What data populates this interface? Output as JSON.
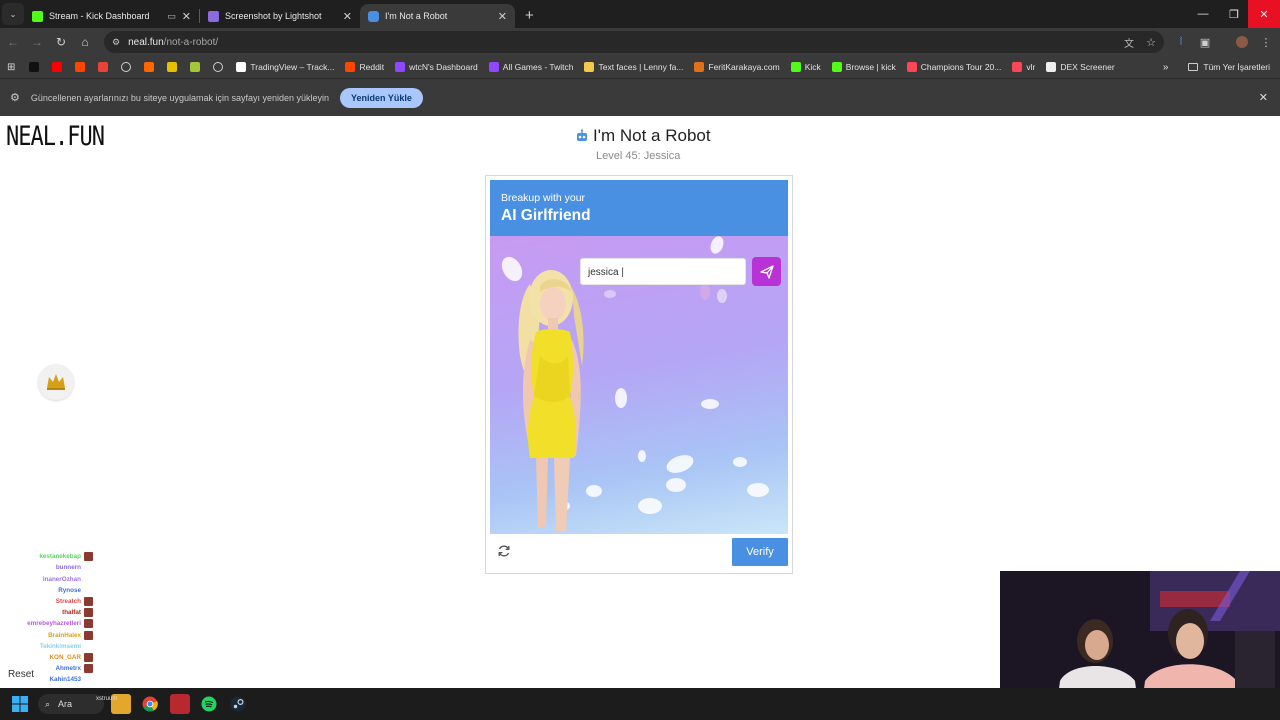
{
  "browser": {
    "tabs": [
      {
        "title": "Stream - Kick Dashboard",
        "favicon_color": "#53fc18",
        "active": false
      },
      {
        "title": "Screenshot by Lightshot",
        "favicon_color": "#8a6be0",
        "active": false
      },
      {
        "title": "I'm Not a Robot",
        "favicon_color": "#4a90e2",
        "active": true
      }
    ],
    "address": {
      "host": "neal.fun",
      "path": "/not-a-robot/"
    },
    "bookmarks": [
      {
        "label": "",
        "icon": "x-icon",
        "color": "#111111"
      },
      {
        "label": "",
        "icon": "youtube-icon",
        "color": "#ff0000"
      },
      {
        "label": "",
        "icon": "reddit-icon",
        "color": "#ff4500"
      },
      {
        "label": "",
        "icon": "gmail-icon",
        "color": "#ea4335"
      },
      {
        "label": "",
        "icon": "globe-icon",
        "color": "#cfcfcf"
      },
      {
        "label": "",
        "icon": "y-icon",
        "color": "#ff6600"
      },
      {
        "label": "",
        "icon": "g-icon",
        "color": "#e5c100"
      },
      {
        "label": "",
        "icon": "android-icon",
        "color": "#a4c639"
      },
      {
        "label": "",
        "icon": "globe-icon",
        "color": "#cfcfcf"
      },
      {
        "label": "TradingView – Track...",
        "icon": "tradingview-icon",
        "color": "#ffffff"
      },
      {
        "label": "Reddit",
        "icon": "reddit-icon",
        "color": "#ff4500"
      },
      {
        "label": "wtcN's Dashboard",
        "icon": "twitch-icon",
        "color": "#9146ff"
      },
      {
        "label": "All Games - Twitch",
        "icon": "twitch-icon",
        "color": "#9146ff"
      },
      {
        "label": "Text faces | Lenny fa...",
        "icon": "face-icon",
        "color": "#f2c94c"
      },
      {
        "label": "FeritKarakaya.com",
        "icon": "site-icon",
        "color": "#e0701a"
      },
      {
        "label": "Kick",
        "icon": "kick-icon",
        "color": "#53fc18"
      },
      {
        "label": "Browse | kick",
        "icon": "kick-icon",
        "color": "#53fc18"
      },
      {
        "label": "Champions Tour 20...",
        "icon": "valorant-icon",
        "color": "#ff4655"
      },
      {
        "label": "vlr",
        "icon": "vlr-icon",
        "color": "#ff4655"
      },
      {
        "label": "DEX Screener",
        "icon": "dex-icon",
        "color": "#eeeeee"
      }
    ],
    "bookmarks_all": "Tüm Yer İşaretleri",
    "infobar": {
      "message": "Güncellenen ayarlarınızı bu siteye uygulamak için sayfayı yeniden yükleyin",
      "button": "Yeniden Yükle"
    }
  },
  "page": {
    "logo": "NEAL.FUN",
    "title": "I'm Not a Robot",
    "level": "Level 45: Jessica",
    "captcha": {
      "header_small": "Breakup with your",
      "header_big": "AI Girlfriend",
      "input_value": "jessica |",
      "verify_label": "Verify"
    }
  },
  "stream": {
    "chat": [
      {
        "user": "",
        "msg": "",
        "color": "#61d46b",
        "emote": false
      },
      {
        "user": "kestanekebap",
        "msg": "",
        "color": "#5ad85a",
        "emote": true
      },
      {
        "user": "bunnern",
        "msg": "",
        "color": "#8a6be0",
        "emote": false
      },
      {
        "user": "InanerOzhan",
        "msg": "",
        "color": "#a374e8",
        "emote": false
      },
      {
        "user": "Rynose",
        "msg": "",
        "color": "#3f6fd6",
        "emote": false
      },
      {
        "user": "Streatch",
        "msg": "",
        "color": "#d94a4a",
        "emote": true
      },
      {
        "user": "thalfat",
        "msg": "",
        "color": "#b0261c",
        "emote": true
      },
      {
        "user": "emrebeyhazretleri",
        "msg": "",
        "color": "#b65ce0",
        "emote": true
      },
      {
        "user": "BrainHalex",
        "msg": "",
        "color": "#d9a21a",
        "emote": true
      },
      {
        "user": "Tekinkimsemi",
        "msg": "",
        "color": "#86cfe8",
        "emote": false
      },
      {
        "user": "KON_GAR",
        "msg": "",
        "color": "#e08a1a",
        "emote": true
      },
      {
        "user": "Ahmetrx",
        "msg": "",
        "color": "#3f6fd6",
        "emote": true
      },
      {
        "user": "Kahin1453",
        "msg": "",
        "color": "#3f6fd6",
        "emote": false
      }
    ],
    "reset": "Reset",
    "overlay_text": "xstruum"
  },
  "taskbar": {
    "search": "Ara"
  }
}
